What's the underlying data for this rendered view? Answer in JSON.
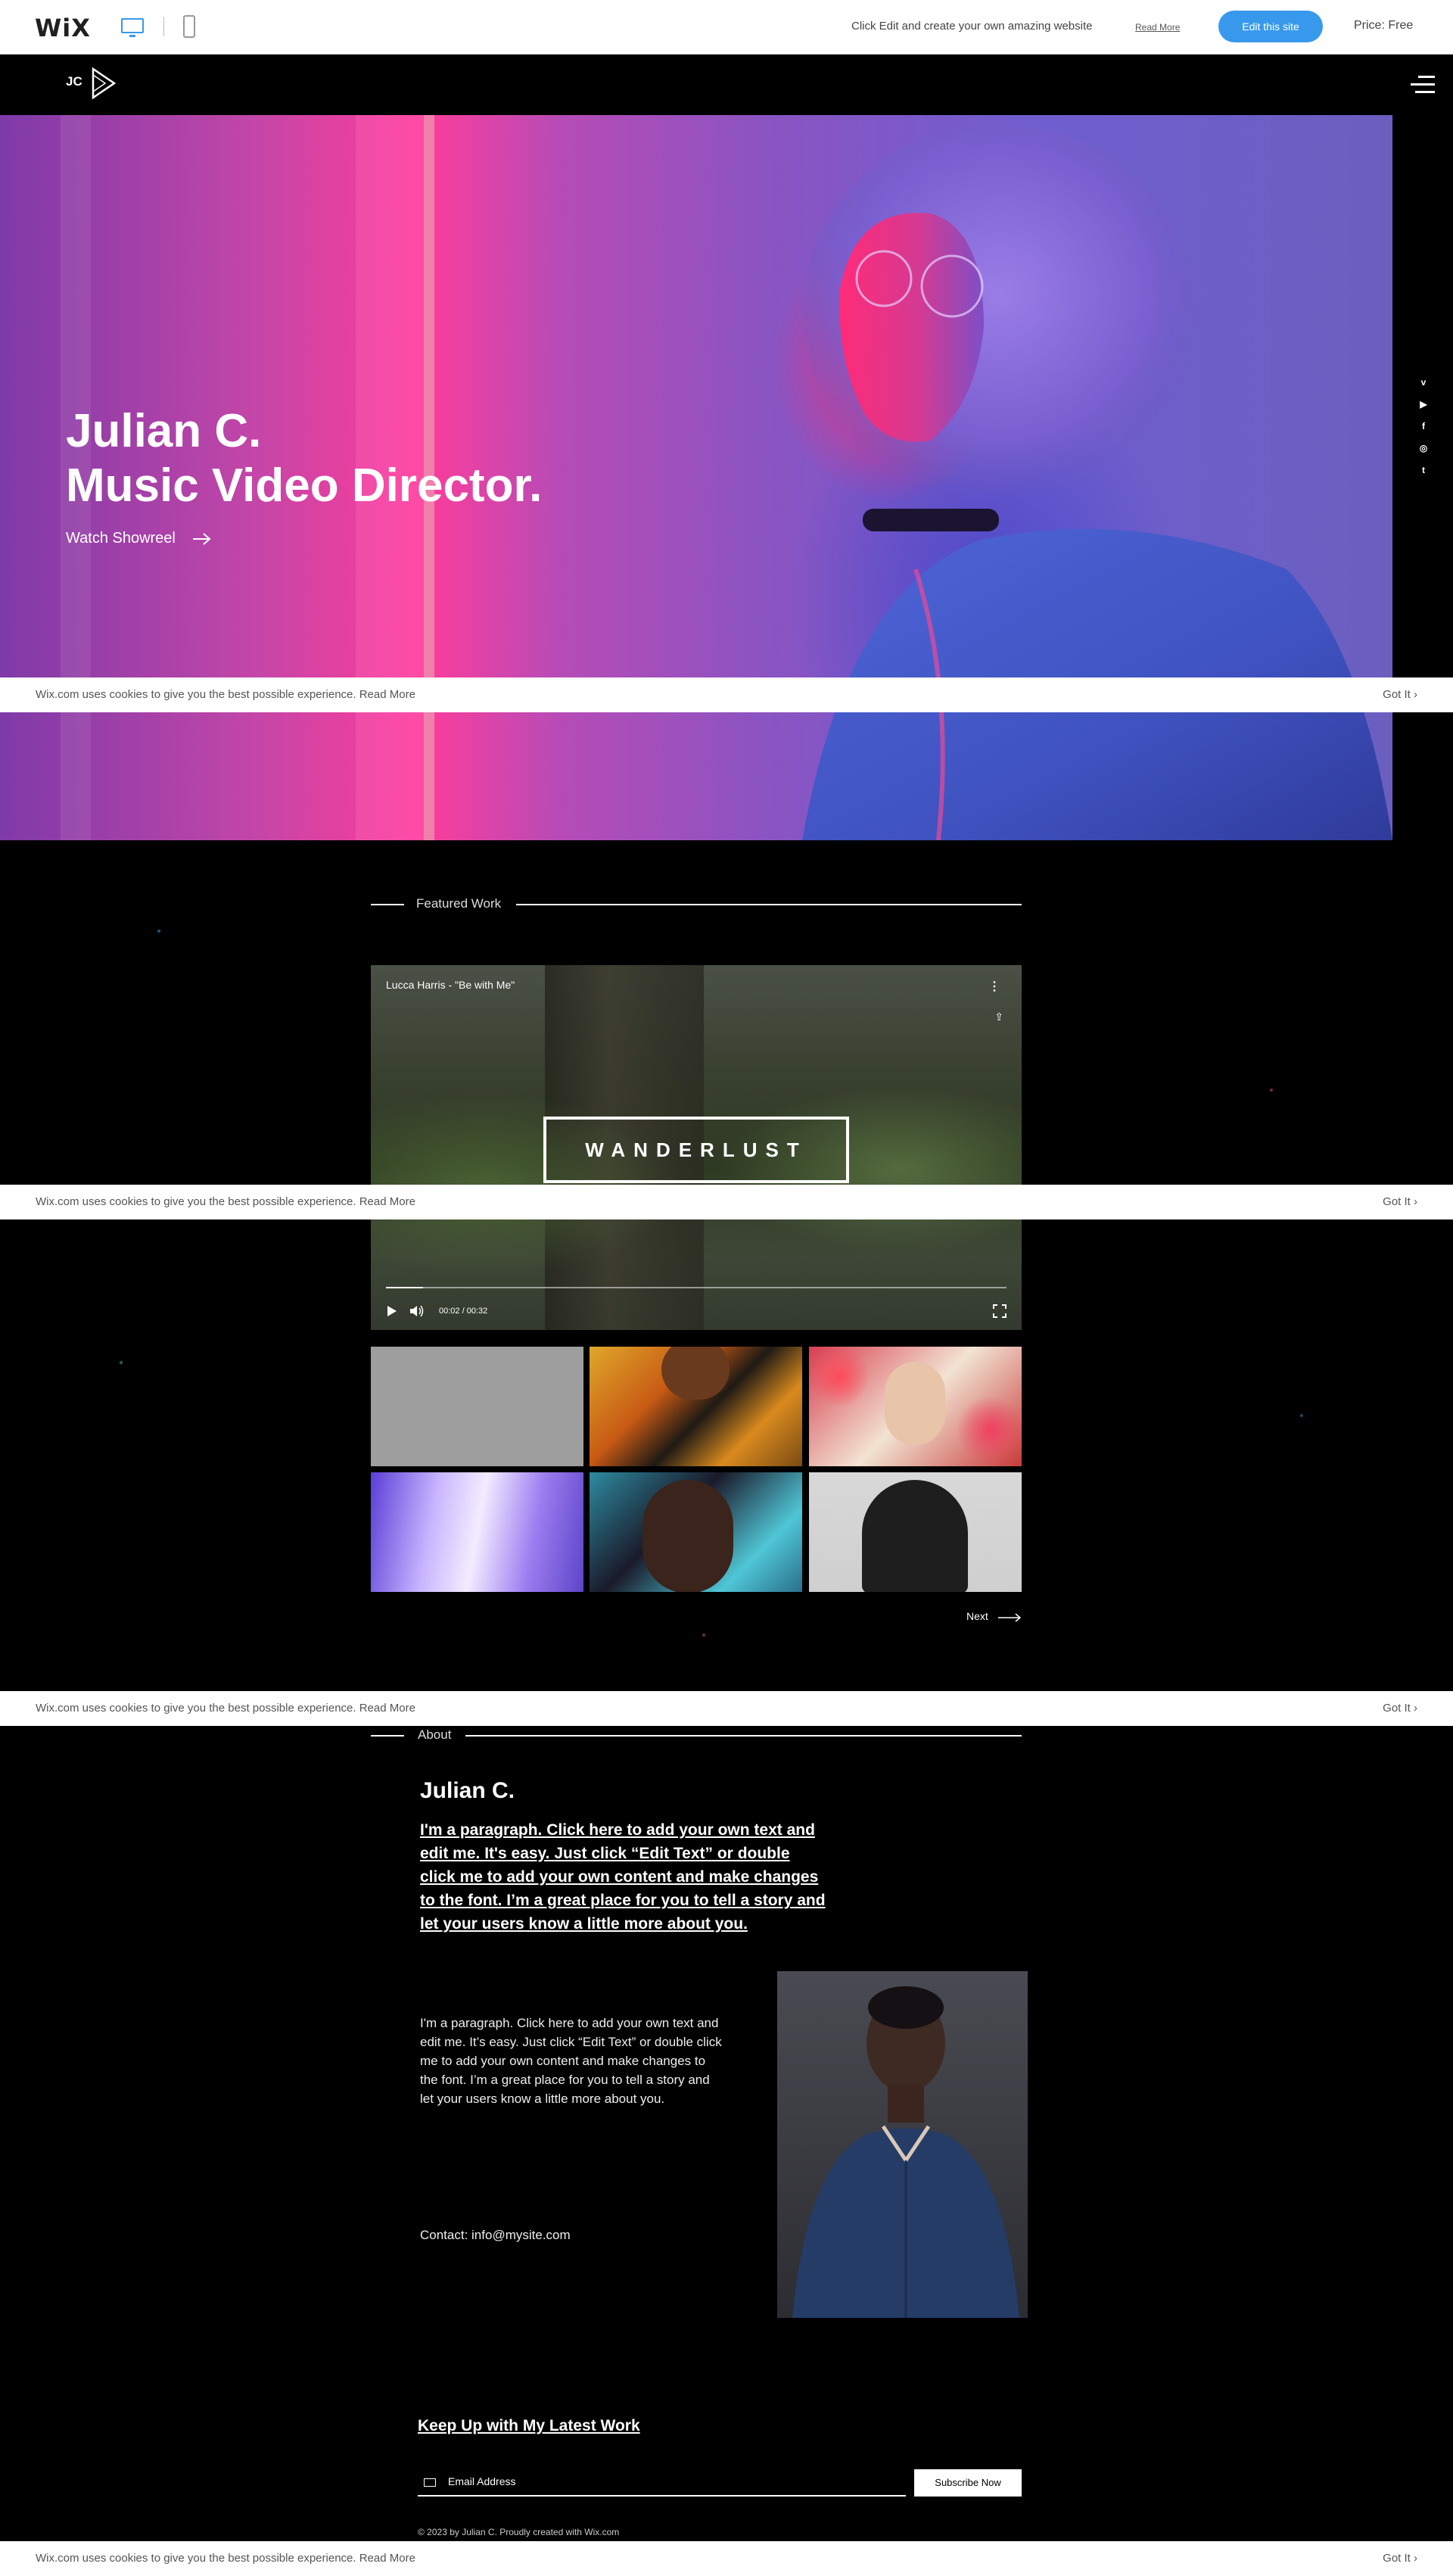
{
  "wixbar": {
    "logo": "WiX",
    "message": "Click Edit and create your own amazing website",
    "read_more": "Read More",
    "edit_button": "Edit this site",
    "price": "Price: Free",
    "colors": {
      "accent": "#3899ec"
    }
  },
  "header": {
    "logo_text": "JC",
    "logo_icon": "play-triangle-icon",
    "menu_icon": "hamburger-menu-icon"
  },
  "hero": {
    "title_line1": "Julian C.",
    "title_line2": "Music Video Director.",
    "link_label": "Watch Showreel"
  },
  "social": {
    "icons": [
      "vimeo-icon",
      "youtube-icon",
      "facebook-icon",
      "instagram-icon",
      "twitter-icon"
    ],
    "glyphs": [
      "v",
      "▶",
      "f",
      "◎",
      "t"
    ]
  },
  "cookie": {
    "message": "Wix.com uses cookies to give you the best possible experience. Read More",
    "got_it": "Got It ›"
  },
  "featured": {
    "label": "Featured Work",
    "video": {
      "title": "Lucca Harris - \"Be with Me\"",
      "banner": "WANDERLUST",
      "time": "00:02 / 00:32",
      "progress": 0.06
    },
    "next_label": "Next"
  },
  "about": {
    "label": "About",
    "name": "Julian C.",
    "lead": "I'm a paragraph. Click here to add your own text and edit me. It's easy. Just click “Edit Text” or double click me to add your own content and make changes to the font. I’m a great place for you to tell a story and let your users know a little more about you.",
    "body": "I'm a paragraph. Click here to add your own text and edit me. It’s easy. Just click “Edit Text” or double click me to add your own content and make changes to the font. I’m a great place for you to tell a story and let your users know a little more about you.",
    "contact": "Contact: info@mysite.com"
  },
  "newsletter": {
    "title": "Keep Up with My Latest Work",
    "email_placeholder": "Email Address",
    "subscribe_label": "Subscribe Now",
    "copyright": "© 2023 by Julian C. Proudly created with Wix.com"
  }
}
